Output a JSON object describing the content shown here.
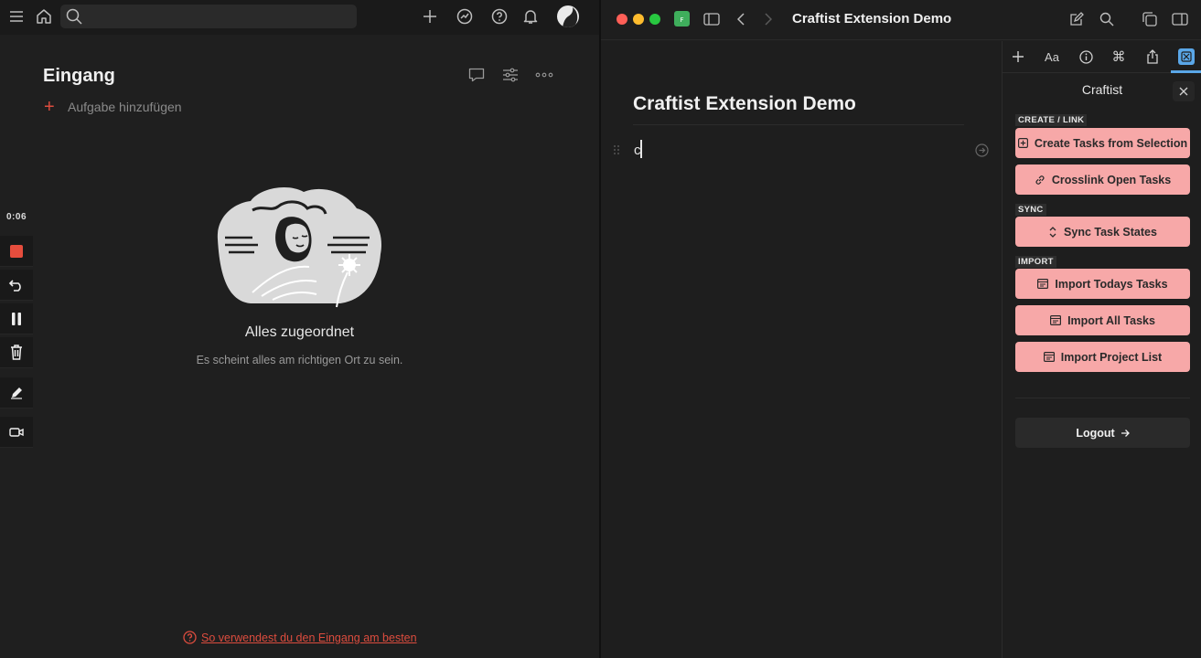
{
  "todoist": {
    "page_title": "Eingang",
    "add_task_label": "Aufgabe hinzufügen",
    "empty_title": "Alles zugeordnet",
    "empty_description": "Es scheint alles am richtigen Ort zu sein.",
    "help_link": "So verwendest du den Eingang am besten",
    "accent_color": "#dc4c3e"
  },
  "recorder": {
    "time": "0:06"
  },
  "craft": {
    "window_title": "Craftist Extension Demo",
    "doc_title": "Craftist Extension Demo",
    "doc_text": "c"
  },
  "craftist": {
    "panel_title": "Craftist",
    "sections": {
      "create_link": "CREATE / LINK",
      "sync": "SYNC",
      "import": "IMPORT"
    },
    "buttons": {
      "create_tasks": "Create Tasks from Selection",
      "crosslink": "Crosslink Open Tasks",
      "sync_states": "Sync Task States",
      "import_todays": "Import Todays Tasks",
      "import_all": "Import All Tasks",
      "import_projects": "Import Project List",
      "logout": "Logout"
    },
    "button_color": "#f7a8a8"
  }
}
